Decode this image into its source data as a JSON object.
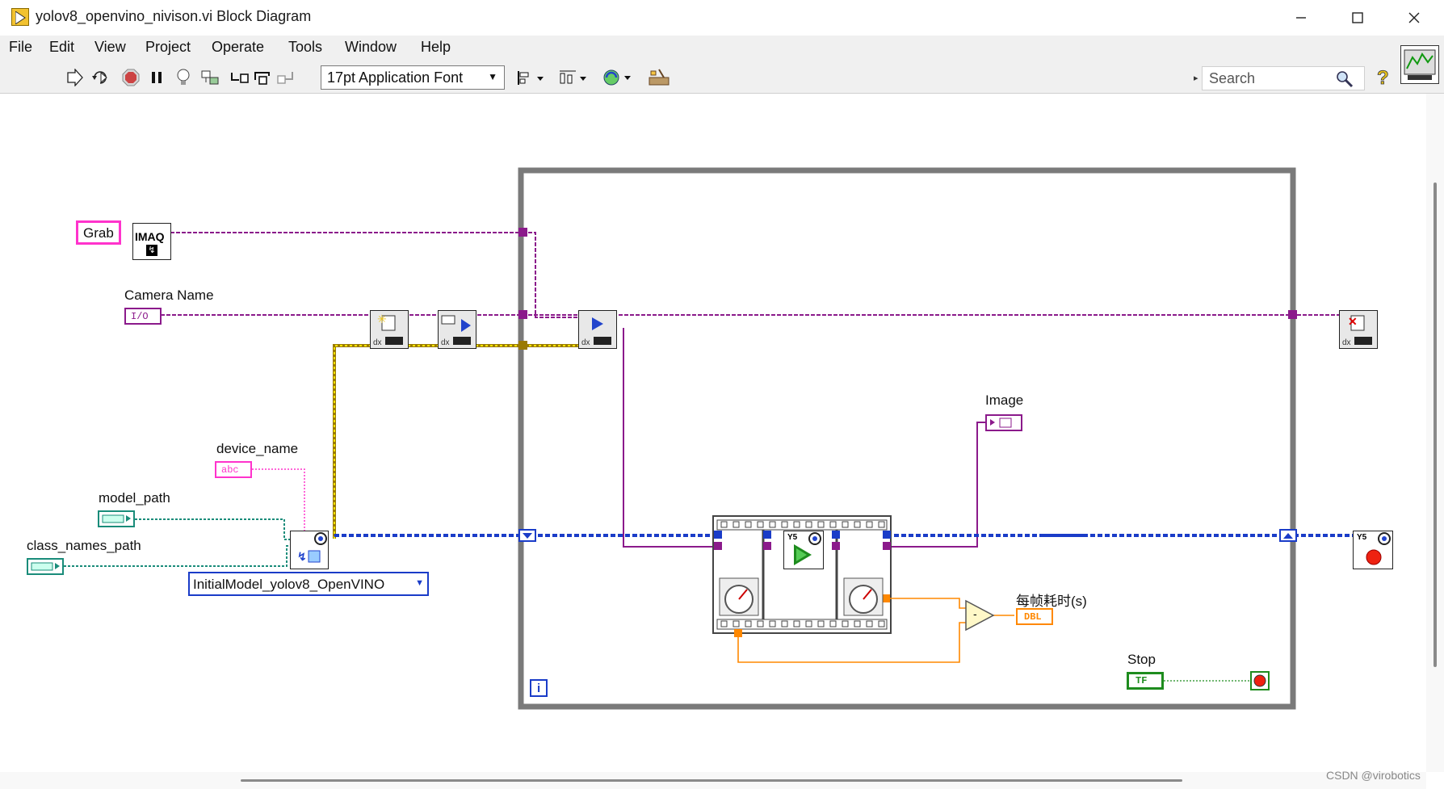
{
  "window": {
    "title": "yolov8_openvino_nivison.vi Block Diagram",
    "controls": {
      "minimize_icon": "minimize-icon",
      "maximize_icon": "maximize-icon",
      "close_icon": "close-icon"
    }
  },
  "menu": {
    "items": [
      "File",
      "Edit",
      "View",
      "Project",
      "Operate",
      "Tools",
      "Window",
      "Help"
    ]
  },
  "toolbar": {
    "font_select": "17pt Application Font",
    "search_placeholder": "Search",
    "icons": [
      "run-arrow-icon",
      "run-continuously-icon",
      "abort-icon",
      "pause-icon",
      "highlight-execution-icon",
      "retain-wire-values-icon",
      "step-into-icon",
      "step-over-icon",
      "step-out-icon",
      "align-objects-icon",
      "distribute-objects-icon",
      "reorder-icon",
      "clean-up-diagram-icon",
      "search-icon",
      "help-icon"
    ]
  },
  "diagram": {
    "terminals": {
      "grab": "Grab",
      "camera_name": "Camera Name",
      "device_name": "device_name",
      "model_path": "model_path",
      "class_names_path": "class_names_path",
      "image": "Image",
      "frame_time": "每帧耗时(s)",
      "stop": "Stop"
    },
    "type_badges": {
      "io": "I/O",
      "abc": "abc",
      "dbl": "DBL",
      "tf": "TF",
      "imaq": "IMAQ",
      "y5": "Y5",
      "loop_index": "i",
      "subtract": "-"
    },
    "polymorphic_selector": "InitialModel_yolov8_OpenVINO"
  },
  "colors": {
    "image_wire": "#8b1a8b",
    "refnum_wire": "#9a7a00",
    "model_wire": "#1a3cc8",
    "path_wire": "#1a8c7a",
    "string_wire": "#ff33cc",
    "dbl_wire": "#ff8800",
    "bool_wire": "#1e8c1e",
    "loop_border": "#7a7a7a"
  },
  "watermark": "CSDN @virobotics"
}
